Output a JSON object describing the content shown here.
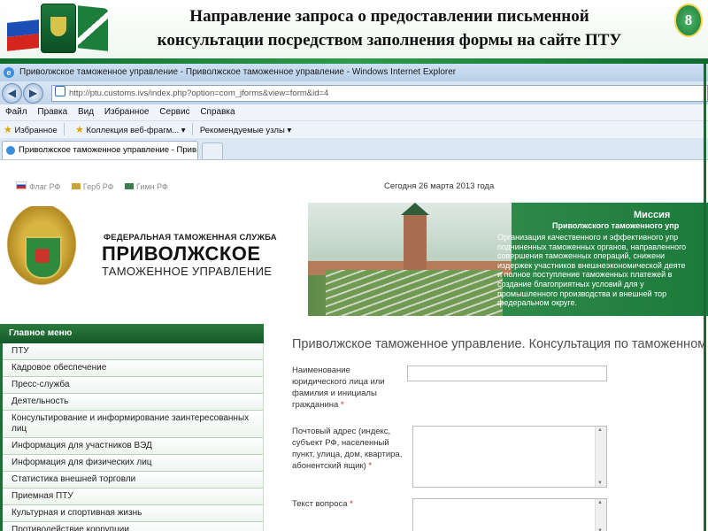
{
  "slide": {
    "title_line1": "Направление запроса о предоставлении письменной",
    "title_line2": "консультации посредством заполнения формы на сайте ПТУ",
    "number": "8"
  },
  "browser": {
    "window_title": "Приволжское таможенное управление - Приволжское таможенное управление - Windows Internet Explorer",
    "url": "http://ptu.customs.ivs/index.php?option=com_jforms&view=form&id=4",
    "menu": [
      "Файл",
      "Правка",
      "Вид",
      "Избранное",
      "Сервис",
      "Справка"
    ],
    "favorites_label": "Избранное",
    "fav_links": [
      "Коллекция веб-фрагм...",
      "Рекомендуемые узлы"
    ],
    "tab_title": "Приволжское таможенное управление - Прив..."
  },
  "page": {
    "top_links": [
      "Флаг РФ",
      "Герб РФ",
      "Гимн РФ"
    ],
    "date_text": "Сегодня 26 марта 2013 года",
    "org": {
      "line1": "ФЕДЕРАЛЬНАЯ ТАМОЖЕННАЯ СЛУЖБА",
      "line2": "ПРИВОЛЖСКОЕ",
      "line3": "ТАМОЖЕННОЕ УПРАВЛЕНИЕ"
    },
    "mission": {
      "title": "Миссия",
      "subtitle": "Приволжского таможенного упр",
      "lines": [
        "Организация качественного и эффективного упр",
        "подчиненных таможенных органов, направленного",
        "совершения таможенных операций, снижени",
        "издержек участников внешнеэкономической деяте",
        "и полное поступление таможенных платежей в",
        "создание благоприятных условий для у",
        "промышленного производства и внешней тор",
        "федеральном округе."
      ]
    },
    "sidebar": {
      "header": "Главное меню",
      "items": [
        "ПТУ",
        "Кадровое обеспечение",
        "Пресс-служба",
        "Деятельность",
        "Консультирование и информирование заинтересованных лиц",
        "Информация для участников ВЭД",
        "Информация для физических лиц",
        "Статистика внешней торговли",
        "Приемная ПТУ",
        "Культурная и спортивная жизнь",
        "Противодействие коррупции"
      ]
    },
    "form": {
      "title": "Приволжское таможенное управление. Консультация по таможенном",
      "field1_label": "Наименование юридического лица или фамилия и инициалы гражданина",
      "field2_label": "Почтовый адрес (индекс, субъект РФ, населенный пункт, улица, дом, квартира, абонентский ящик)",
      "field3_label": "Текст вопроса",
      "required_mark": "*",
      "field1_value": "",
      "field2_value": "",
      "field3_value": ""
    }
  },
  "colors": {
    "accent_green": "#1f6e35",
    "required_red": "#c0271d"
  }
}
